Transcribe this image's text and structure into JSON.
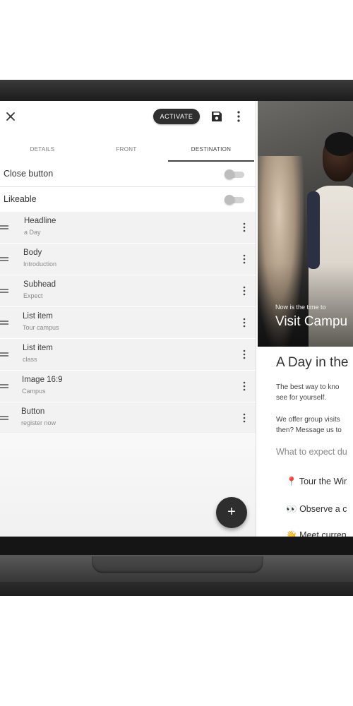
{
  "toolbar": {
    "close": "✕",
    "activate_label": "ACTIVATE",
    "save_icon": "save-icon",
    "more_icon": "more-vert-icon"
  },
  "tabs": [
    {
      "label": "DETAILS",
      "active": false
    },
    {
      "label": "FRONT",
      "active": false
    },
    {
      "label": "DESTINATION",
      "active": true
    }
  ],
  "toggles": [
    {
      "label": "Close button",
      "on": false
    },
    {
      "label": "Likeable",
      "on": false
    }
  ],
  "blocks": [
    {
      "title": "Headline",
      "subtitle": "a Day"
    },
    {
      "title": "Body",
      "subtitle": "Introduction"
    },
    {
      "title": "Subhead",
      "subtitle": "Expect"
    },
    {
      "title": "List item",
      "subtitle": "Tour campus"
    },
    {
      "title": "List item",
      "subtitle": "class"
    },
    {
      "title": "Image 16:9",
      "subtitle": "Campus"
    },
    {
      "title": "Button",
      "subtitle": "register now"
    }
  ],
  "fab_label": "+",
  "preview": {
    "kicker": "Now is the time to",
    "hero_title": "Visit Campu",
    "title": "A Day in the",
    "body1_line1": "The best way to kno",
    "body1_line2": "see for yourself.",
    "body2_line1": "We offer group visits",
    "body2_line2": "then? Message us to",
    "subhead": "What to expect du",
    "list": [
      {
        "emoji": "📍",
        "text": "Tour the Wir"
      },
      {
        "emoji": "👀",
        "text": "Observe a c"
      },
      {
        "emoji": "👋",
        "text": "Meet curren"
      }
    ]
  },
  "colors": {
    "accent": "#2f2f2f",
    "list_bg": "#f2f2f2"
  }
}
